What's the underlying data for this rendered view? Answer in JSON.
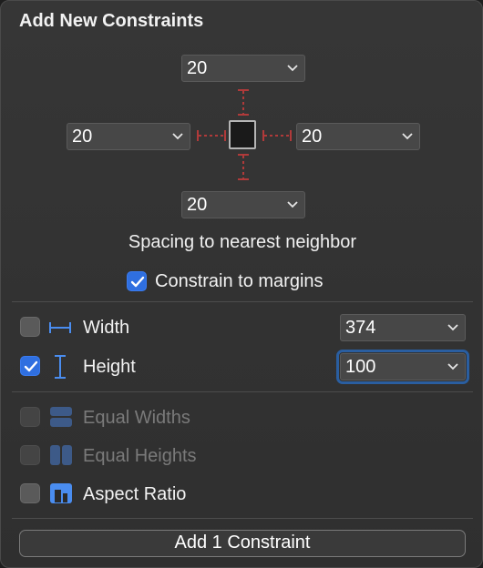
{
  "panel": {
    "title": "Add New Constraints"
  },
  "spacing": {
    "top": "20",
    "left": "20",
    "right": "20",
    "bottom": "20",
    "label": "Spacing to nearest neighbor"
  },
  "margins": {
    "label": "Constrain to margins",
    "checked": true
  },
  "size": {
    "width": {
      "label": "Width",
      "value": "374",
      "checked": false
    },
    "height": {
      "label": "Height",
      "value": "100",
      "checked": true
    }
  },
  "equal": {
    "widths": {
      "label": "Equal Widths",
      "enabled": false
    },
    "heights": {
      "label": "Equal Heights",
      "enabled": false
    },
    "aspect": {
      "label": "Aspect Ratio",
      "enabled": true
    }
  },
  "action": {
    "add_label": "Add 1 Constraint"
  },
  "colors": {
    "accent": "#2f6fe0",
    "strut": "#b03a3a",
    "icon": "#4a8df0"
  }
}
